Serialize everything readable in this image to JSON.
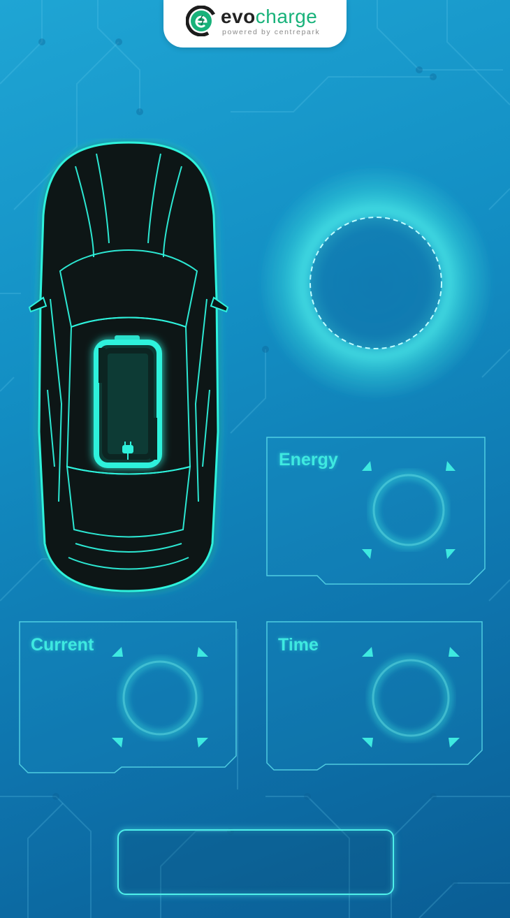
{
  "brand": {
    "name_part1": "evo",
    "name_part2": "charge",
    "tagline": "powered by centrepark",
    "logo_icon": "evocharge-logo-icon",
    "accent_green": "#18b27a"
  },
  "vehicle": {
    "icon": "car-top-view-icon",
    "battery_icon": "battery-icon",
    "plug_icon": "plug-icon"
  },
  "charging_indicator": {
    "icon": "charging-ring-icon"
  },
  "panels": {
    "energy": {
      "label": "Energy",
      "value": ""
    },
    "current": {
      "label": "Current",
      "value": ""
    },
    "time": {
      "label": "Time",
      "value": ""
    }
  },
  "action_button": {
    "label": ""
  },
  "colors": {
    "neon": "#3ee9e0",
    "background_top": "#1fa5d4",
    "background_bottom": "#0a5d94"
  }
}
